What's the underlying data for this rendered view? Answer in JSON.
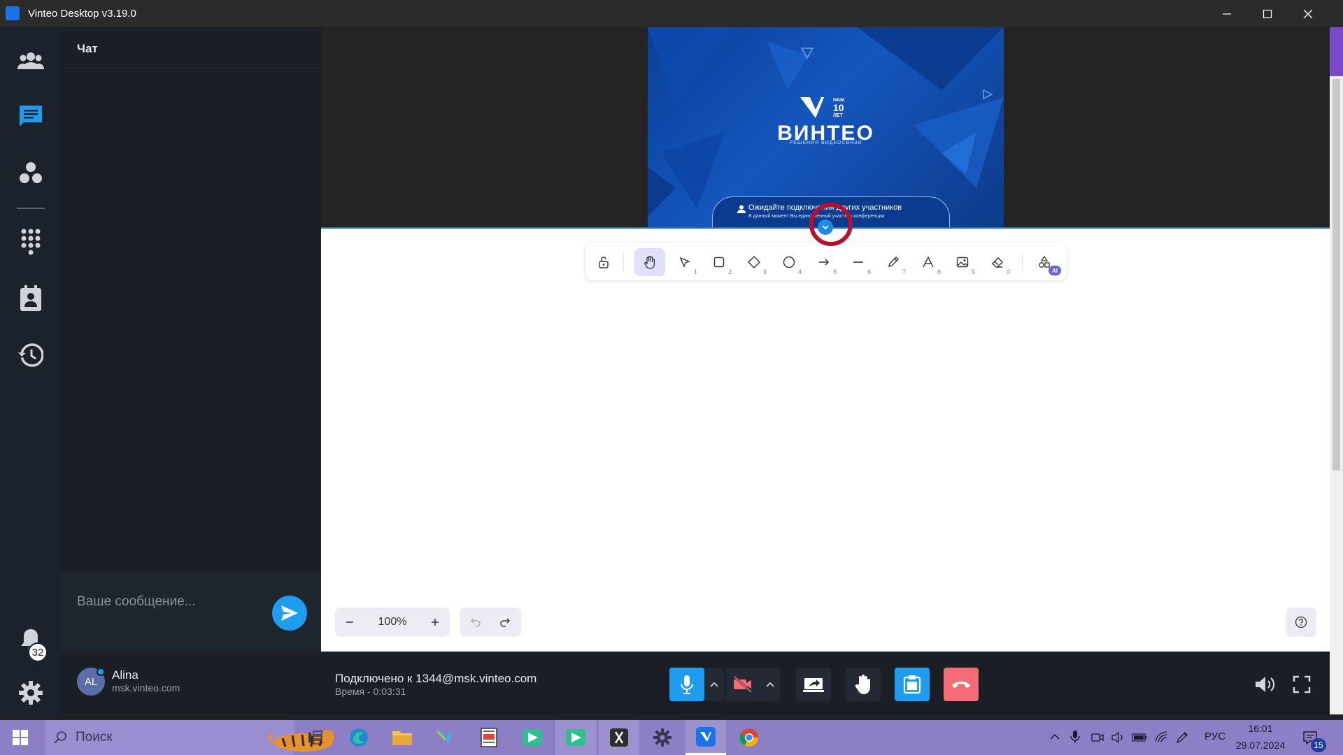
{
  "window": {
    "title": "Vinteo Desktop v3.19.0"
  },
  "sidebar": {
    "items": [
      {
        "icon": "participants-icon"
      },
      {
        "icon": "chat-icon",
        "active": true
      },
      {
        "icon": "groups-icon"
      },
      {
        "icon": "dialpad-icon"
      },
      {
        "icon": "contacts-icon"
      },
      {
        "icon": "history-icon"
      }
    ],
    "notifications_count": "32"
  },
  "chat": {
    "title": "Чат",
    "input_placeholder": "Ваше сообщение..."
  },
  "slide": {
    "brand": "ВИНТЕО",
    "years_line1": "НАМ",
    "years_line2": "10",
    "years_line3": "ЛЕТ",
    "subtitle": "РЕШЕНИЯ ВИДЕОСВЯЗИ",
    "wait_title": "Ожидайте подключения других участников",
    "wait_sub": "В данный момент Вы единственный участник конференции"
  },
  "whiteboard": {
    "tools": [
      {
        "name": "lock",
        "num": ""
      },
      {
        "name": "hand",
        "num": ""
      },
      {
        "name": "select",
        "num": "1"
      },
      {
        "name": "rectangle",
        "num": "2"
      },
      {
        "name": "diamond",
        "num": "3"
      },
      {
        "name": "ellipse",
        "num": "4"
      },
      {
        "name": "arrow",
        "num": "5"
      },
      {
        "name": "line",
        "num": "6"
      },
      {
        "name": "draw",
        "num": "7"
      },
      {
        "name": "text",
        "num": "8"
      },
      {
        "name": "image",
        "num": "9"
      },
      {
        "name": "eraser",
        "num": "0"
      },
      {
        "name": "more-shapes",
        "num": ""
      }
    ],
    "ai_badge": "AI",
    "zoom": "100%"
  },
  "user": {
    "initials": "AL",
    "name": "Alina",
    "server": "msk.vinteo.com"
  },
  "call": {
    "connected_to": "Подключено к 1344@msk.vinteo.com",
    "time": "Время - 0:03:31"
  },
  "taskbar": {
    "search_label": "Поиск",
    "lang": "РУС",
    "time": "16:01",
    "date": "29.07.2024",
    "notif_count": "15"
  },
  "colors": {
    "accent": "#1e9cf0",
    "hangup": "#f56c78",
    "taskbar": "#8d7fc6"
  }
}
